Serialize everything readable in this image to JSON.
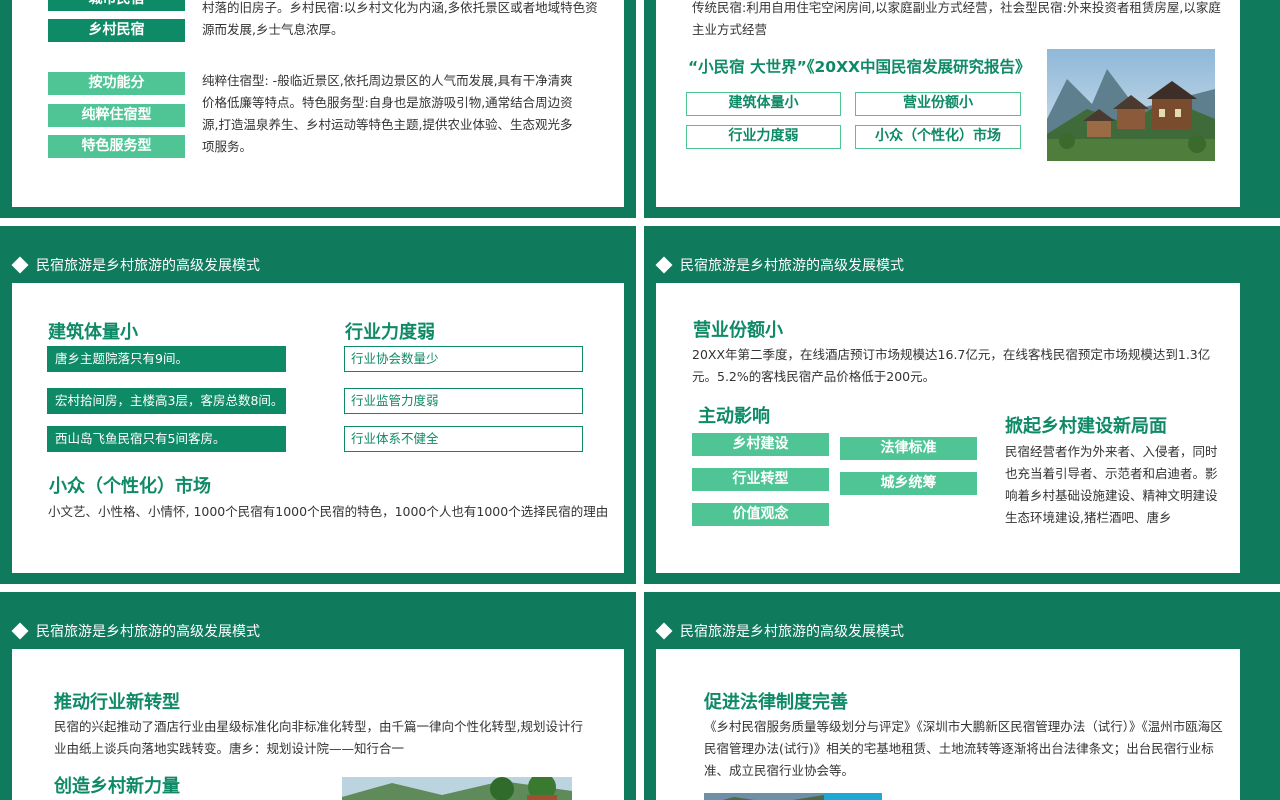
{
  "slide1": {
    "tags_top": [
      "城市民宿",
      "乡村民宿"
    ],
    "text_top": "村落的旧房子。乡村民宿:以乡村文化为内涵,多依托景区或者地域特色资源而发展,乡士气息浓厚。",
    "tags_func": [
      "按功能分",
      "纯粹住宿型",
      "特色服务型"
    ],
    "text_func": "纯粹住宿型: -般临近景区,依托周边景区的人气而发展,具有干净清爽价格低廉等特点。特色服务型:自身也是旅游吸引物,通常结合周边资源,打造温泉养生、乡村运动等特色主题,提供农业体验、生态观光多项服务。"
  },
  "slide2": {
    "text_top": "传统民宿:利用自用住宅空闲房间,以家庭副业方式经营，社会型民宿:外来投资者租赁房屋,以家庭主业方式经营",
    "report_title": "“小民宿 大世界”《20XX中国民宿发展研究报告》",
    "tags": [
      "建筑体量小",
      "营业份额小",
      "行业力度弱",
      "小众（个性化）市场"
    ]
  },
  "slide3": {
    "title": "民宿旅游是乡村旅游的高级发展模式",
    "h_left": "建筑体量小",
    "bars_left": [
      "唐乡主题院落只有9间。",
      "宏村拾间房，主楼高3层，客房总数8间。",
      "西山岛飞鱼民宿只有5间客房。"
    ],
    "h_right": "行业力度弱",
    "bars_right": [
      "行业协会数量少",
      "行业监管力度弱",
      "行业体系不健全"
    ],
    "h_bottom": "小众（个性化）市场",
    "text_bottom": "小文艺、小性格、小情怀, 1000个民宿有1000个民宿的特色，1000个人也有1000个选择民宿的理由"
  },
  "slide4": {
    "title": "民宿旅游是乡村旅游的高级发展模式",
    "h_share": "营业份额小",
    "text_share": "20XX年第二季度，在线酒店预订市场规模达16.7亿元，在线客栈民宿预定市场规模达到1.3亿元。5.2%的客栈民宿产品价格低于200元。",
    "h_influence": "主动影响",
    "tags_left": [
      "乡村建设",
      "行业转型",
      "价值观念"
    ],
    "tags_right": [
      "法律标准",
      "城乡统筹"
    ],
    "h_new": "掀起乡村建设新局面",
    "text_new": "民宿经营者作为外来者、入侵者，同时也充当着引导者、示范者和启迪者。影响着乡村基础设施建设、精神文明建设生态环境建设,猪栏酒吧、唐乡"
  },
  "slide5": {
    "title": "民宿旅游是乡村旅游的高级发展模式",
    "h1": "推动行业新转型",
    "text1": "民宿的兴起推动了酒店行业由星级标准化向非标准化转型，由千篇一律向个性化转型,规划设计行业由纸上谈兵向落地实践转变。唐乡：规划设计院——知行合一",
    "h2": "创造乡村新力量"
  },
  "slide6": {
    "title": "民宿旅游是乡村旅游的高级发展模式",
    "h1": "促进法律制度完善",
    "text1": "《乡村民宿服务质量等级划分与评定》《深圳市大鹏新区民宿管理办法（试行）》《温州市瓯海区民宿管理办法(试行)》相关的宅基地租赁、土地流转等逐渐将出台法律条文；出台民宿行业标准、成立民宿行业协会等。"
  },
  "colors": {
    "brand_green": "#0f7a5c",
    "accent_green": "#4fc596"
  }
}
